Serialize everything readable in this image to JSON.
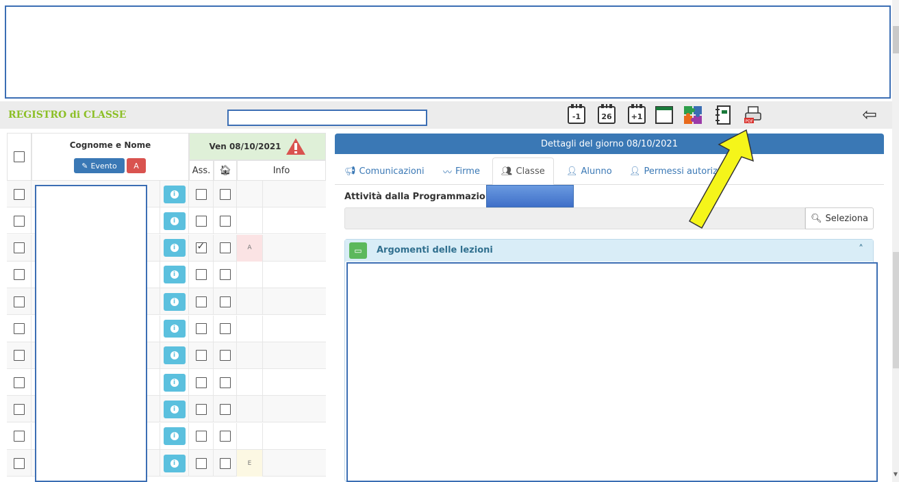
{
  "toolbar": {
    "title": "REGISTRO di CLASSE",
    "icons": [
      "calendar-prev-icon",
      "calendar-today-icon",
      "calendar-next-icon",
      "window-icon",
      "puzzle-icon",
      "notebook-icon",
      "print-pdf-icon"
    ],
    "cal_prev": "-1",
    "cal_today": "26",
    "cal_next": "+1",
    "back": "⇦"
  },
  "table": {
    "name_header": "Cognome e Nome",
    "evento_label": "Evento",
    "a_label": "A",
    "date_header": "Ven 08/10/2021",
    "ass_label": "Ass.",
    "info_label": "Info",
    "rows": [
      {
        "ass": false,
        "tag": ""
      },
      {
        "ass": false,
        "tag": ""
      },
      {
        "ass": true,
        "tag": "A"
      },
      {
        "ass": false,
        "tag": ""
      },
      {
        "ass": false,
        "tag": ""
      },
      {
        "ass": false,
        "tag": ""
      },
      {
        "ass": false,
        "tag": ""
      },
      {
        "ass": false,
        "tag": ""
      },
      {
        "ass": false,
        "tag": ""
      },
      {
        "ass": false,
        "tag": ""
      },
      {
        "ass": false,
        "tag": "E"
      }
    ]
  },
  "details": {
    "header": "Dettagli del giorno 08/10/2021",
    "tabs": [
      "Comunicazioni",
      "Firme",
      "Classe",
      "Alunno",
      "Permessi autorizz"
    ],
    "prog_label": "Attività dalla Programmazione",
    "select_label": "Seleziona",
    "arg_title": "Argomenti delle lezioni"
  },
  "colors": {
    "accent": "#3a78b5",
    "title_green": "#8cbf26",
    "info": "#5bc0de",
    "danger": "#d9534f",
    "arrow": "#f5f51a"
  }
}
